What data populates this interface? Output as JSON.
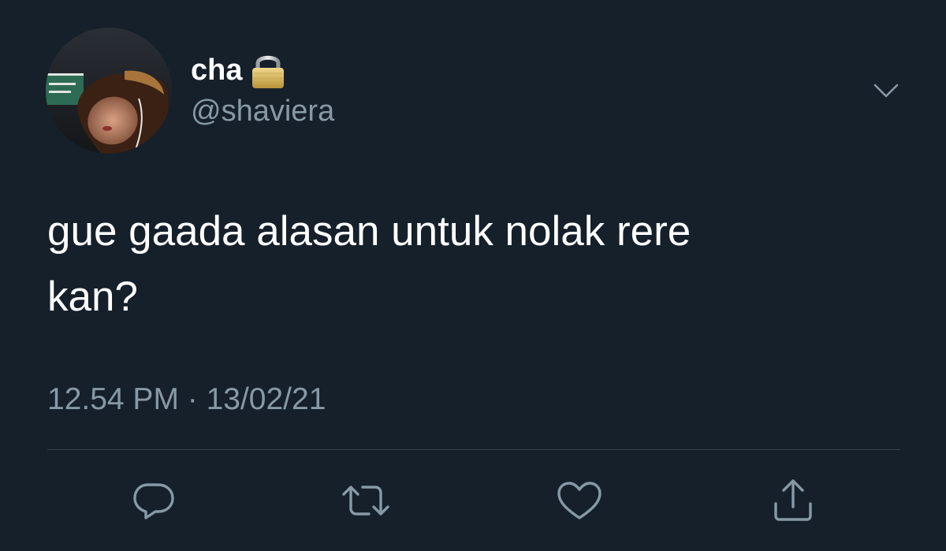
{
  "author": {
    "display_name": "cha",
    "username": "@shaviera",
    "protected_icon": "lock-icon",
    "avatar_icon": "profile-photo"
  },
  "tweet": {
    "text": "gue gaada alasan untuk nolak rere\nkan?",
    "timestamp": "12.54 PM · 13/02/21"
  },
  "menu": {
    "icon": "chevron-down-icon"
  },
  "actions": [
    {
      "name": "reply",
      "icon": "speech-bubble-icon"
    },
    {
      "name": "retweet",
      "icon": "retweet-icon"
    },
    {
      "name": "like",
      "icon": "heart-icon"
    },
    {
      "name": "share",
      "icon": "share-icon"
    }
  ],
  "colors": {
    "background": "#15202b",
    "primary_text": "#ffffff",
    "secondary_text": "#8899a6",
    "divider": "#38444d",
    "lock": "#d4b35a"
  }
}
